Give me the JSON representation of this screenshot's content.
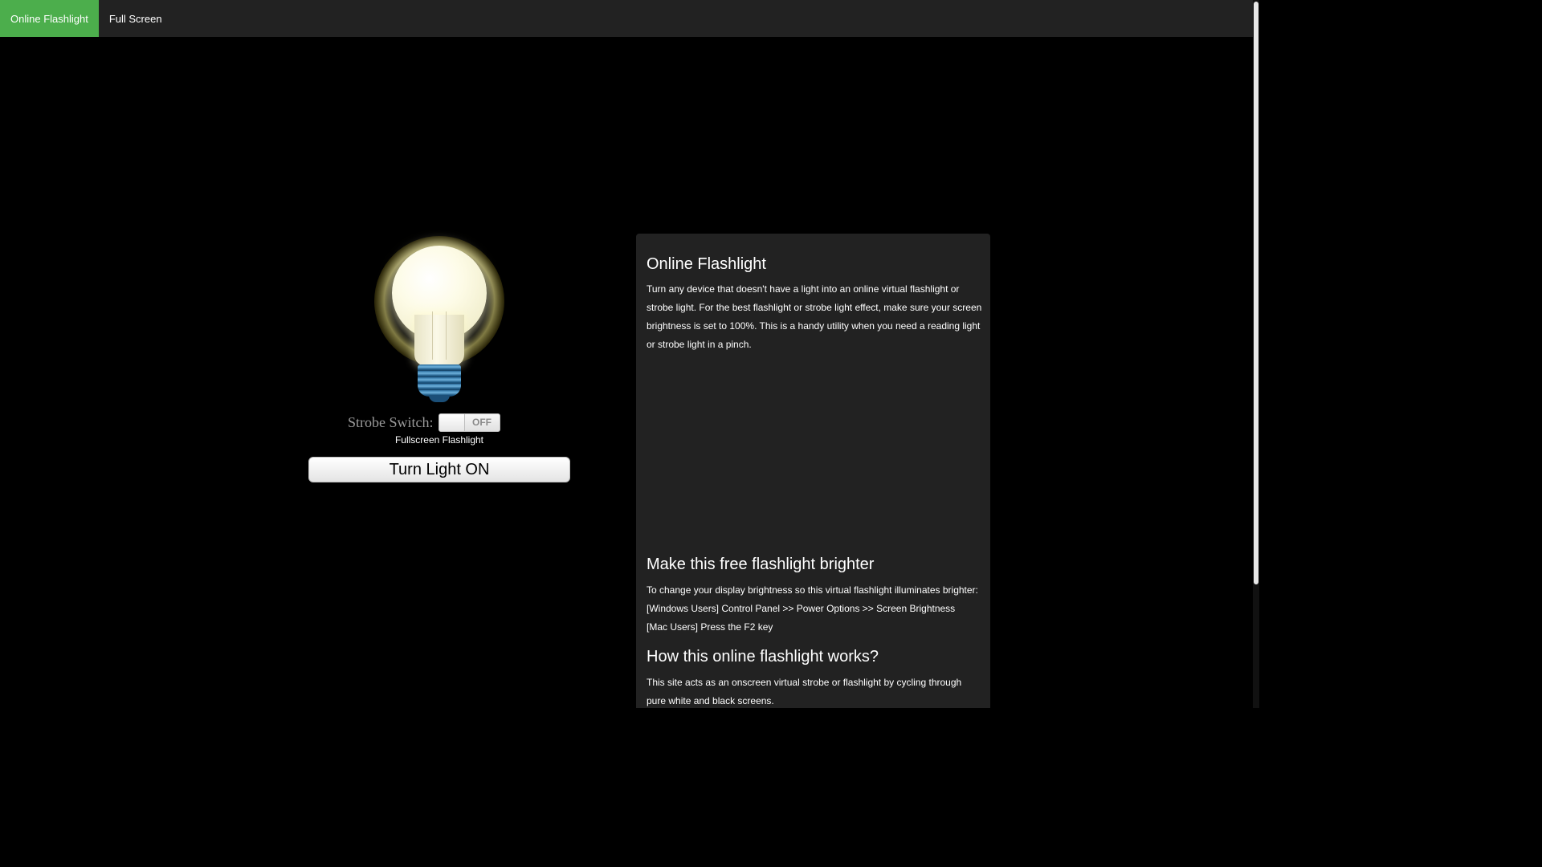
{
  "nav": {
    "items": [
      {
        "label": "Online Flashlight",
        "active": true
      },
      {
        "label": "Full Screen",
        "active": false
      }
    ]
  },
  "controls": {
    "strobe_label": "Strobe Switch:",
    "strobe_state": "OFF",
    "fullscreen_link": "Fullscreen Flashlight",
    "light_button": "Turn Light ON"
  },
  "panel": {
    "title": "Online Flashlight",
    "intro": "Turn any device that doesn't have a light into an online virtual flashlight or strobe light. For the best flashlight or strobe light effect, make sure your screen brightness is set to 100%. This is a handy utility when you need a reading light or strobe light in a pinch.",
    "brighter_title": "Make this free flashlight brighter",
    "brighter_lines": [
      "To change your display brightness so this virtual flashlight illuminates brighter:",
      "[Windows Users] Control Panel >> Power Options >> Screen Brightness",
      "[Mac Users] Press the F2 key"
    ],
    "how_title": "How this online flashlight works?",
    "how_text": "This site acts as an onscreen virtual strobe or flashlight by cycling through pure white and black screens."
  },
  "colors": {
    "active_nav": "#4cae4c",
    "navbar": "#222222",
    "background": "#000000",
    "panel": "#222222"
  },
  "icons": {
    "bulb": "light-bulb-icon"
  }
}
